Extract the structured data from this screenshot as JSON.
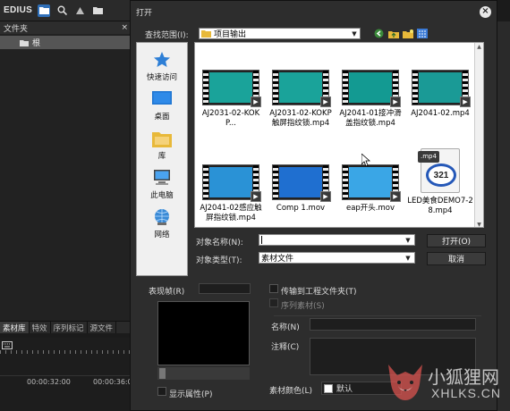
{
  "app": {
    "logo": "EDIUS",
    "toolbar_icons": [
      "folder-icon",
      "search-icon",
      "up-icon",
      "folder-icon"
    ]
  },
  "bin": {
    "header": "文件夹",
    "close": "×",
    "root_item": "根"
  },
  "bottom_tabs": [
    "素材库",
    "特效",
    "序列标记",
    "源文件"
  ],
  "timecodes": [
    "00:00:32:00",
    "00:00:36:00"
  ],
  "dialog": {
    "title": "打开",
    "lookin_label": "查找范围(I):",
    "lookin_value": "项目输出",
    "places": [
      "快速访问",
      "桌面",
      "库",
      "此电脑",
      "网络"
    ],
    "files": [
      {
        "name": "AJ2031-02-KOKP...",
        "kind": "video",
        "bg": "#1aa39a"
      },
      {
        "name": "AJ2031-02-KOKP触屏指纹锁.mp4",
        "kind": "video",
        "bg": "#1aa39a"
      },
      {
        "name": "AJ2041-01接冲滑盖指纹锁.mp4",
        "kind": "video",
        "bg": "#139a92"
      },
      {
        "name": "AJ2041-02.mp4",
        "kind": "video",
        "bg": "#1a9a96"
      },
      {
        "name": "AJ2041-02感应触屏指纹锁.mp4",
        "kind": "video",
        "bg": "#2a92d6"
      },
      {
        "name": "Comp 1.mov",
        "kind": "video",
        "bg": "#1f6fd0"
      },
      {
        "name": "eap开头.mov",
        "kind": "video",
        "bg": "#3aa6e6"
      },
      {
        "name": "LED美食DEMO7-28.mp4",
        "kind": "mp4",
        "bg": "#f4f4f4"
      }
    ],
    "mp4_tag": ".mp4",
    "mp4_logo": "321",
    "filename_label": "对象名称(N):",
    "filename_value": "",
    "filetype_label": "对象类型(T):",
    "filetype_value": "素材文件",
    "open_button": "打开(O)",
    "cancel_button": "取消",
    "preview_label": "表现帧(R)",
    "transfer_label": "传输到工程文件夹(T)",
    "sequence_label": "序列素材(S)",
    "name_label": "名称(N)",
    "comment_label": "注释(C)",
    "show_props_label": "显示属性(P)",
    "clip_color_label": "素材颜色(L)",
    "clip_color_value": "默认"
  },
  "watermark": {
    "text": "小狐狸网",
    "url": "XHLKS.CN"
  }
}
